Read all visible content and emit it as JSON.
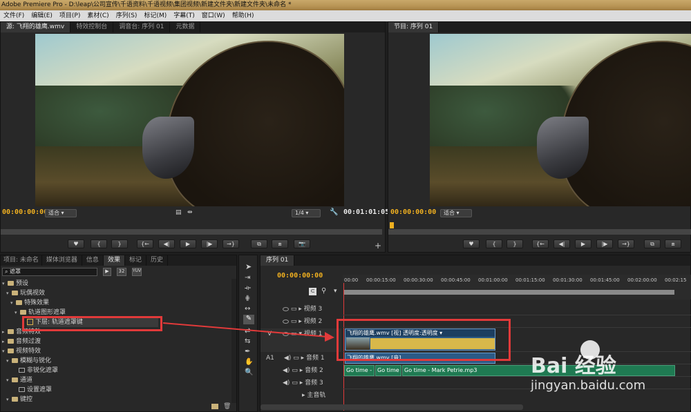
{
  "window": {
    "title": "Adobe Premiere Pro - D:\\leap\\公司宣传\\千语资料\\千语视频\\集团视频\\新建文件夹\\新建文件夹\\未命名 *"
  },
  "menu": [
    "文件(F)",
    "编辑(E)",
    "项目(P)",
    "素材(C)",
    "序列(S)",
    "标记(M)",
    "字幕(T)",
    "窗口(W)",
    "帮助(H)"
  ],
  "source_panel": {
    "tabs": [
      "源: 飞翔的雄鹰.wmv",
      "特效控制台",
      "调音台: 序列 01",
      "元数据"
    ],
    "timecode_in": "00:00:00:00",
    "fit": "适合",
    "resolution": "1/4",
    "timecode_out": "00:01:01:05",
    "buttons": [
      "♥",
      "{",
      "}",
      "{←",
      "◀|",
      "▶",
      "|▶",
      "→}",
      "⧉",
      "⧈",
      "📷"
    ],
    "add": "+"
  },
  "program_panel": {
    "tabs": [
      "节目: 序列 01"
    ],
    "timecode_in": "00:00:00:00",
    "fit": "适合",
    "buttons": [
      "♥",
      "{",
      "}",
      "{←",
      "◀|",
      "▶",
      "|▶",
      "→}",
      "⧉",
      "⧈"
    ]
  },
  "project_panel": {
    "tabs": [
      "项目: 未命名",
      "媒体浏览器",
      "信息",
      "效果",
      "标记",
      "历史"
    ],
    "search_value": "遮罩",
    "badges": [
      "32",
      "YUV"
    ],
    "tree": [
      {
        "label": "预设",
        "level": 0,
        "type": "folder"
      },
      {
        "label": "玩偶视效",
        "level": 1,
        "type": "folder"
      },
      {
        "label": "特殊效果",
        "level": 2,
        "type": "folder"
      },
      {
        "label": "轨道图形遮罩",
        "level": 3,
        "type": "folder"
      },
      {
        "label": "下层: 轨道遮罩键",
        "level": 4,
        "type": "effect"
      },
      {
        "label": "音频特效",
        "level": 0,
        "type": "folder"
      },
      {
        "label": "音频过渡",
        "level": 0,
        "type": "folder"
      },
      {
        "label": "视频特效",
        "level": 0,
        "type": "folder"
      },
      {
        "label": "模糊与锐化",
        "level": 1,
        "type": "folder"
      },
      {
        "label": "非锐化遮罩",
        "level": 2,
        "type": "effect"
      },
      {
        "label": "通道",
        "level": 1,
        "type": "folder"
      },
      {
        "label": "设置遮罩",
        "level": 2,
        "type": "effect"
      },
      {
        "label": "键控",
        "level": 1,
        "type": "folder"
      }
    ]
  },
  "timeline": {
    "tabs": [
      "序列 01"
    ],
    "timecode": "00:00:00:00",
    "ruler": [
      "00:00",
      "00:00:15:00",
      "00:00:30:00",
      "00:00:45:00",
      "00:01:00:00",
      "00:01:15:00",
      "00:01:30:00",
      "00:01:45:00",
      "00:02:00:00",
      "00:02:15"
    ],
    "tracks": [
      {
        "label": "视频 3",
        "prefix": ""
      },
      {
        "label": "视频 2",
        "prefix": ""
      },
      {
        "label": "视频 1",
        "prefix": "V"
      },
      {
        "label": "音频 1",
        "prefix": "A1"
      },
      {
        "label": "音频 2",
        "prefix": ""
      },
      {
        "label": "音频 3",
        "prefix": ""
      },
      {
        "label": "主音轨",
        "prefix": ""
      }
    ],
    "video_clip_title": "飞翔的雄鹰.wmv [视] 透明度:透明度 ▾",
    "audio_clip_title": "飞翔的雄鹰.wmv [音]",
    "audio2_clips": [
      "Go time - M",
      "Go time -",
      "Go time - Mark Petrie.mp3"
    ]
  },
  "watermark": {
    "logo": "Bai 经验",
    "url": "jingyan.baidu.com"
  },
  "colors": {
    "timecode": "#f0b020",
    "accent_red": "#e23a3a",
    "video_clip": "#2c5a86",
    "audio_clip": "#1f7a52"
  }
}
